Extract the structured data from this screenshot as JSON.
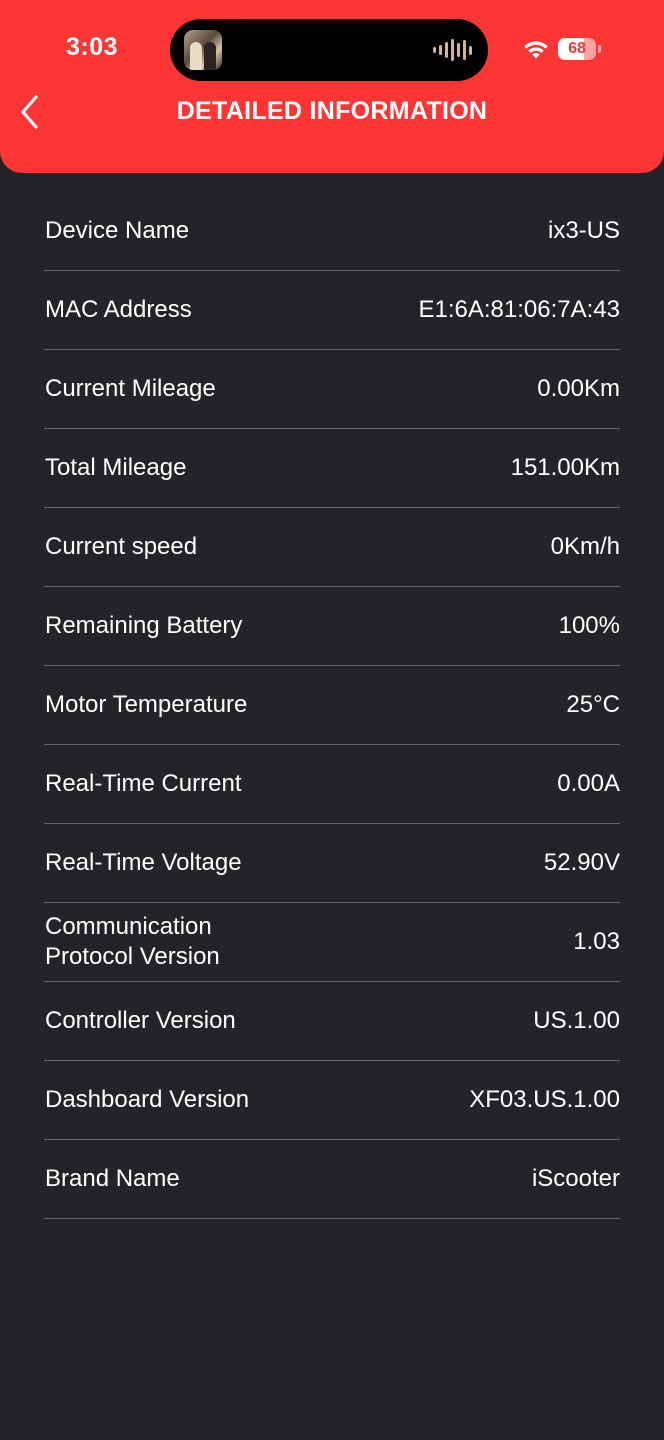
{
  "status_bar": {
    "time": "3:03",
    "battery_level": 68,
    "battery_label": "68"
  },
  "header": {
    "title": "DETAILED INFORMATION",
    "background": "#fb3434"
  },
  "details": [
    {
      "label": "Device Name",
      "value": "ix3-US"
    },
    {
      "label": "MAC Address",
      "value": "E1:6A:81:06:7A:43"
    },
    {
      "label": "Current Mileage",
      "value": "0.00Km"
    },
    {
      "label": "Total Mileage",
      "value": "151.00Km"
    },
    {
      "label": "Current speed",
      "value": "0Km/h"
    },
    {
      "label": "Remaining Battery",
      "value": "100%"
    },
    {
      "label": "Motor Temperature",
      "value": "25°C"
    },
    {
      "label": "Real-Time Current",
      "value": "0.00A"
    },
    {
      "label": "Real-Time Voltage",
      "value": "52.90V"
    },
    {
      "label": "Communication Protocol Version",
      "value": "1.03"
    },
    {
      "label": "Controller Version",
      "value": "US.1.00"
    },
    {
      "label": "Dashboard Version",
      "value": "XF03.US.1.00"
    },
    {
      "label": "Brand Name",
      "value": "iScooter"
    }
  ]
}
